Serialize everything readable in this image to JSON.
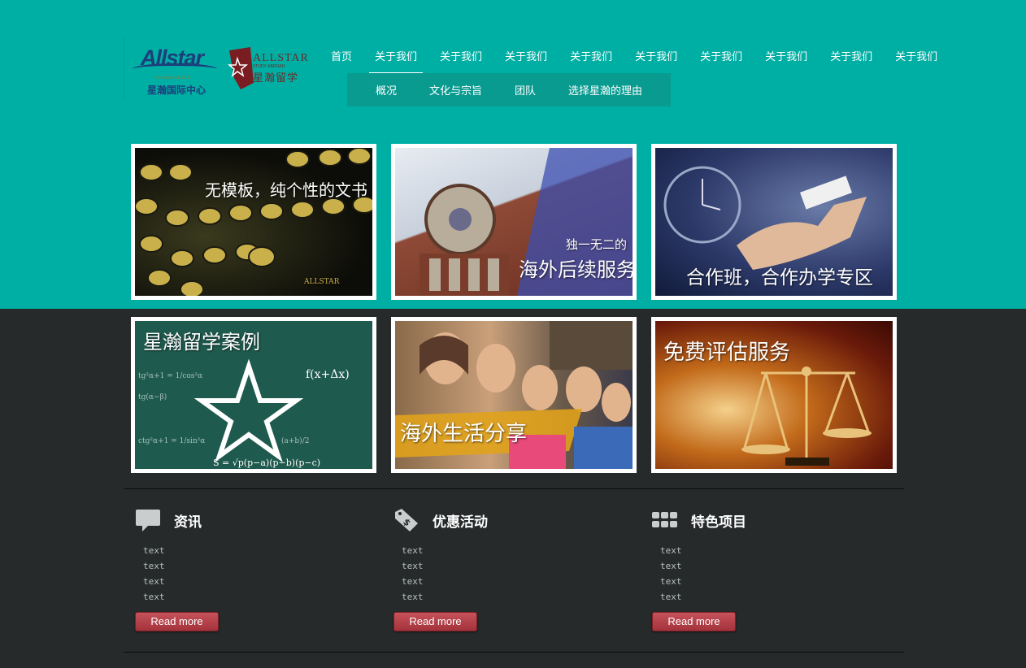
{
  "logo": {
    "primary_text": "Allstar",
    "primary_sub": "International LLC",
    "primary_cn": "星瀚国际中心",
    "secondary_text": "ALLSTAR",
    "secondary_sub": "STUDY ABROAD",
    "secondary_cn": "星瀚留学"
  },
  "nav": {
    "items": [
      "首页",
      "关于我们",
      "关于我们",
      "关于我们",
      "关于我们",
      "关于我们",
      "关于我们",
      "关于我们",
      "关于我们",
      "关于我们"
    ],
    "active_index": 1
  },
  "subnav": {
    "items": [
      "概况",
      "文化与宗旨",
      "团队",
      "选择星瀚的理由"
    ]
  },
  "cards": [
    {
      "caption": "无模板，纯个性的文书",
      "stamp": "ALLSTAR"
    },
    {
      "caption_small": "独一无二的",
      "caption": "海外后续服务"
    },
    {
      "caption": "合作班，合作办学专区"
    },
    {
      "caption": "星瀚留学案例"
    },
    {
      "caption": "海外生活分享"
    },
    {
      "caption": "免费评估服务"
    }
  ],
  "columns": [
    {
      "title": "资讯",
      "icon": "speech-bubble-icon",
      "items": [
        "text",
        "text",
        "text",
        "text"
      ],
      "button": "Read more"
    },
    {
      "title": "优惠活动",
      "icon": "price-tag-icon",
      "items": [
        "text",
        "text",
        "text",
        "text"
      ],
      "button": "Read more"
    },
    {
      "title": "特色项目",
      "icon": "grid-icon",
      "items": [
        "text",
        "text",
        "text",
        "text"
      ],
      "button": "Read more"
    }
  ],
  "colors": {
    "top_band": "#00afa4",
    "subnav_bg": "#0a9b90",
    "body_bg": "#262a2b",
    "button": "#b03c44"
  }
}
